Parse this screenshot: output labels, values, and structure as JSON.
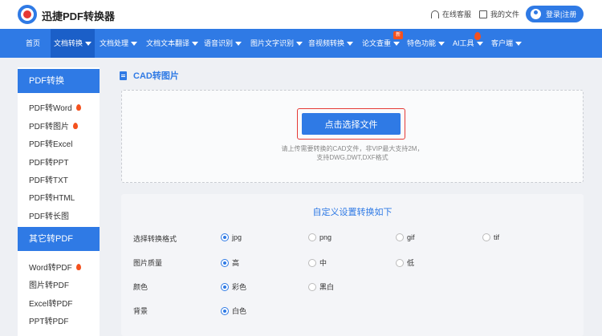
{
  "header": {
    "brand": "迅捷PDF转换器",
    "support": "在线客服",
    "my_files": "我的文件",
    "login": "登录|注册"
  },
  "nav": {
    "items": [
      {
        "label": "首页",
        "dropdown": false
      },
      {
        "label": "文档转换",
        "dropdown": true,
        "active": true
      },
      {
        "label": "文档处理",
        "dropdown": true
      },
      {
        "label": "文档文本翻译",
        "dropdown": true
      },
      {
        "label": "语音识别",
        "dropdown": true
      },
      {
        "label": "图片文字识别",
        "dropdown": true
      },
      {
        "label": "音视频转换",
        "dropdown": true
      },
      {
        "label": "论文查重",
        "dropdown": true,
        "badge": "新"
      },
      {
        "label": "特色功能",
        "dropdown": true
      },
      {
        "label": "AI工具",
        "dropdown": true,
        "hot": true
      },
      {
        "label": "客户端",
        "dropdown": true
      }
    ]
  },
  "sidebar": {
    "section1": {
      "title": "PDF转换",
      "items": [
        {
          "label": "PDF转Word",
          "hot": true
        },
        {
          "label": "PDF转图片",
          "hot": true
        },
        {
          "label": "PDF转Excel",
          "hot": false
        },
        {
          "label": "PDF转PPT",
          "hot": false
        },
        {
          "label": "PDF转TXT",
          "hot": false
        },
        {
          "label": "PDF转HTML",
          "hot": false
        },
        {
          "label": "PDF转长图",
          "hot": false
        }
      ]
    },
    "section2": {
      "title": "其它转PDF",
      "items": [
        {
          "label": "Word转PDF",
          "hot": true
        },
        {
          "label": "图片转PDF",
          "hot": false
        },
        {
          "label": "Excel转PDF",
          "hot": false
        },
        {
          "label": "PPT转PDF",
          "hot": false
        }
      ]
    }
  },
  "main": {
    "title": "CAD转图片",
    "upload_button": "点击选择文件",
    "hint_line1": "请上传需要转换的CAD文件，非VIP最大支持2M，",
    "hint_line2": "支持DWG,DWT,DXF格式"
  },
  "settings": {
    "title": "自定义设置转换如下",
    "rows": [
      {
        "label": "选择转换格式",
        "options": [
          {
            "label": "jpg",
            "selected": true
          },
          {
            "label": "png",
            "selected": false
          },
          {
            "label": "gif",
            "selected": false
          },
          {
            "label": "tif",
            "selected": false
          }
        ]
      },
      {
        "label": "图片质量",
        "options": [
          {
            "label": "高",
            "selected": true
          },
          {
            "label": "中",
            "selected": false
          },
          {
            "label": "低",
            "selected": false
          }
        ]
      },
      {
        "label": "颜色",
        "options": [
          {
            "label": "彩色",
            "selected": true
          },
          {
            "label": "黑白",
            "selected": false
          }
        ]
      },
      {
        "label": "背景",
        "options": [
          {
            "label": "白色",
            "selected": true
          }
        ]
      }
    ]
  },
  "colors": {
    "primary": "#2f7ae5",
    "highlight": "#e53935",
    "hot": "#f4511e"
  }
}
